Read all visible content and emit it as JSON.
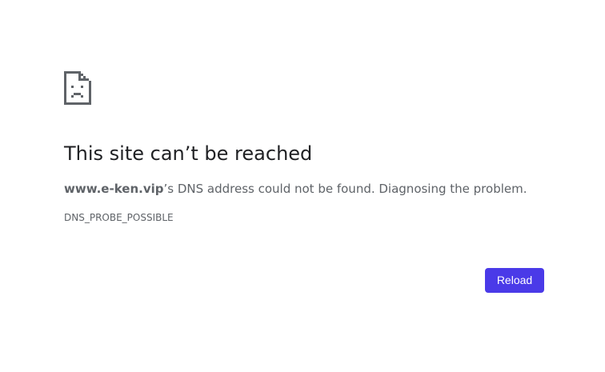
{
  "error": {
    "icon": "sad-page-icon",
    "title": "This site can’t be reached",
    "host": "www.e-ken.vip",
    "message_suffix": "’s DNS address could not be found. Diagnosing the problem.",
    "code": "DNS_PROBE_POSSIBLE"
  },
  "actions": {
    "reload_label": "Reload"
  },
  "colors": {
    "accent": "#4a3ae8",
    "heading": "#202124",
    "text": "#5f6368",
    "icon": "#5f6368"
  }
}
